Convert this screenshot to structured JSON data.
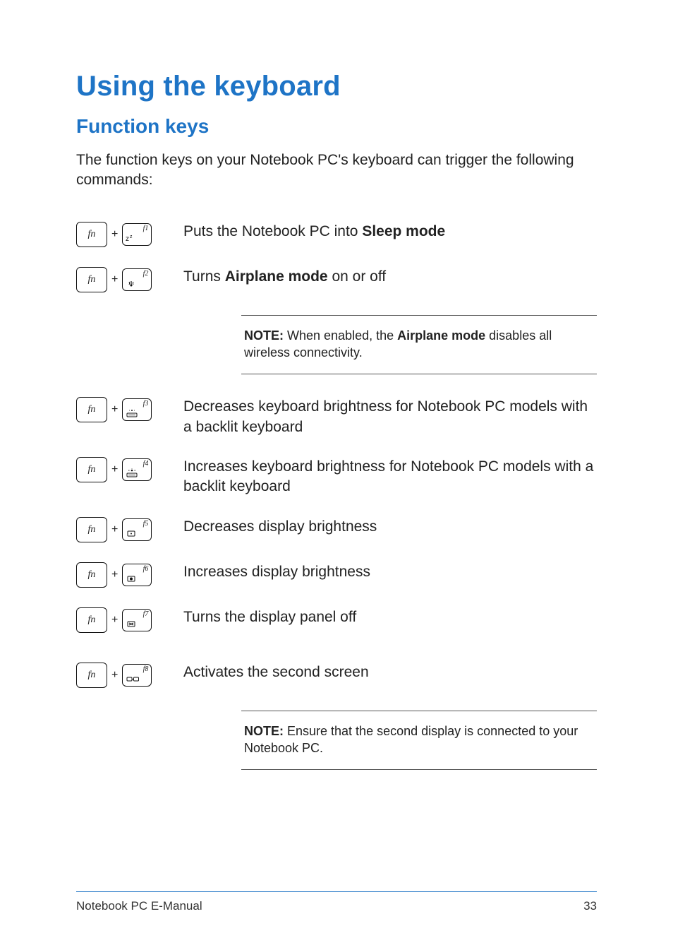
{
  "h1": "Using the keyboard",
  "h2": "Function keys",
  "intro": "The function keys on your Notebook PC's keyboard can trigger the following commands:",
  "fn_label": "fn",
  "plus": "+",
  "rows": [
    {
      "f": "f1",
      "icon": "sleep",
      "pre": "Puts the Notebook PC into ",
      "bold": "Sleep mode",
      "post": ""
    },
    {
      "f": "f2",
      "icon": "wifi",
      "pre": "Turns ",
      "bold": "Airplane mode",
      "post": " on or off"
    },
    {
      "f": "f3",
      "icon": "kb-dim",
      "pre": "Decreases keyboard brightness for Notebook PC models with a backlit keyboard",
      "bold": "",
      "post": ""
    },
    {
      "f": "f4",
      "icon": "kb-bright",
      "pre": "Increases keyboard brightness for Notebook PC models with a backlit keyboard",
      "bold": "",
      "post": ""
    },
    {
      "f": "f5",
      "icon": "sun-dim",
      "pre": "Decreases display brightness",
      "bold": "",
      "post": ""
    },
    {
      "f": "f6",
      "icon": "sun-bright",
      "pre": "Increases display brightness",
      "bold": "",
      "post": ""
    },
    {
      "f": "f7",
      "icon": "screen-off",
      "pre": "Turns the display panel off",
      "bold": "",
      "post": ""
    },
    {
      "f": "f8",
      "icon": "dual-screen",
      "pre": "Activates the second screen",
      "bold": "",
      "post": ""
    }
  ],
  "notes": {
    "after_f2": {
      "label": "NOTE:",
      "pre": " When enabled, the ",
      "bold": "Airplane mode",
      "post": " disables all wireless connectivity."
    },
    "after_f8": {
      "label": "NOTE:",
      "pre": " Ensure that the second display is connected to your Notebook PC.",
      "bold": "",
      "post": ""
    }
  },
  "footer": {
    "title": "Notebook PC E-Manual",
    "page": "33"
  }
}
